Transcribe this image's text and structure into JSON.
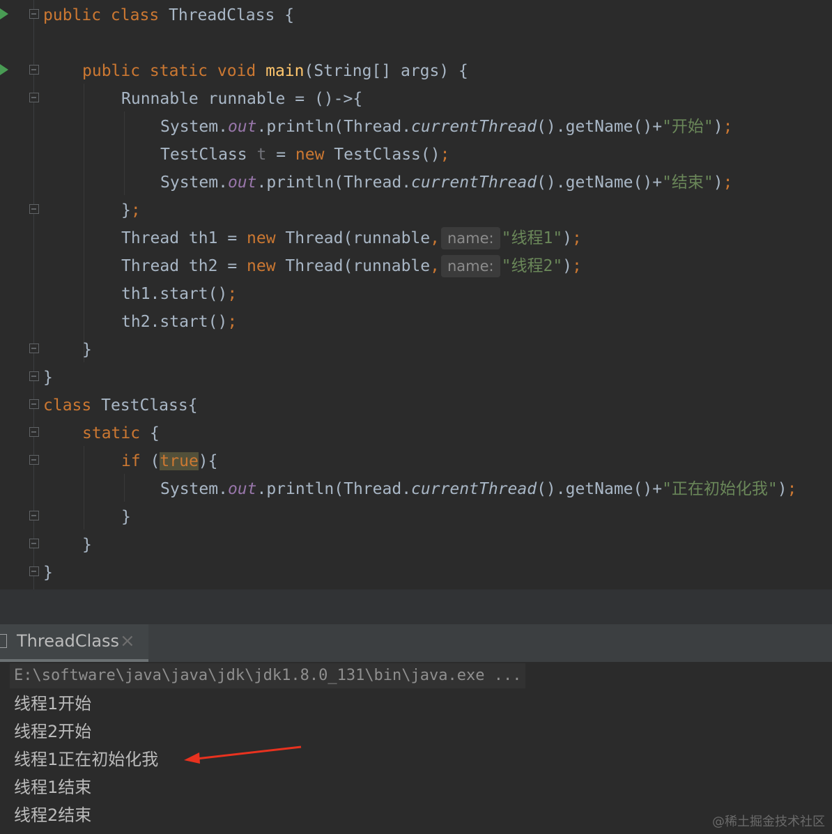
{
  "editor": {
    "line1": {
      "kw": "public class ",
      "name": "ThreadClass",
      "rest": " {"
    },
    "line3": {
      "kw": "public static void ",
      "fn": "main",
      "rest": "(String[] args) {"
    },
    "line4": {
      "text": "Runnable runnable = ()->{"
    },
    "line5": {
      "a": "System.",
      "out": "out",
      "b": ".println(Thread.",
      "ct": "currentThread",
      "c": "().getName()+",
      "str": "\"开始\"",
      "d": ")",
      "semi": ";"
    },
    "line6": {
      "a": "TestClass ",
      "v": "t",
      "b": " = ",
      "kw": "new",
      "c": " TestClass()",
      "semi": ";"
    },
    "line7": {
      "a": "System.",
      "out": "out",
      "b": ".println(Thread.",
      "ct": "currentThread",
      "c": "().getName()+",
      "str": "\"结束\"",
      "d": ")",
      "semi": ";"
    },
    "line8": {
      "a": "}",
      "semi": ";"
    },
    "line9": {
      "a": "Thread th1 = ",
      "kw": "new",
      "b": " Thread(runnable",
      "comma": ",",
      "hint": "name:",
      "str": "\"线程1\"",
      "d": ")",
      "semi": ";"
    },
    "line10": {
      "a": "Thread th2 = ",
      "kw": "new",
      "b": " Thread(runnable",
      "comma": ",",
      "hint": "name:",
      "str": "\"线程2\"",
      "d": ")",
      "semi": ";"
    },
    "line11": {
      "a": "th1.start()",
      "semi": ";"
    },
    "line12": {
      "a": "th2.start()",
      "semi": ";"
    },
    "line13": {
      "a": "}"
    },
    "line14": {
      "a": "}"
    },
    "line15": {
      "kw": "class ",
      "a": "TestClass{"
    },
    "line16": {
      "kw": "static",
      "a": " {"
    },
    "line17": {
      "kw": "if",
      "a": " (",
      "tr": "true",
      "b": "){"
    },
    "line18": {
      "a": "System.",
      "out": "out",
      "b": ".println(Thread.",
      "ct": "currentThread",
      "c": "().getName()+",
      "str": "\"正在初始化我\"",
      "d": ")",
      "semi": ";"
    },
    "line19": {
      "a": "}"
    },
    "line20": {
      "a": "}"
    },
    "line21": {
      "a": "}"
    }
  },
  "run_panel": {
    "tab_label": "ThreadClass",
    "close_glyph": "×",
    "command": "E:\\software\\java\\java\\jdk\\jdk1.8.0_131\\bin\\java.exe ...",
    "output": [
      "线程1开始",
      "线程2开始",
      "线程1正在初始化我",
      "线程1结束",
      "线程2结束"
    ]
  },
  "watermark": "@稀土掘金技术社区",
  "colors": {
    "background": "#2b2b2b",
    "keyword": "#cc7832",
    "method_decl": "#ffc66d",
    "string": "#6a8759",
    "static_field": "#9876aa",
    "text": "#a9b7c6",
    "run_icon": "#499c54",
    "annotation_arrow": "#e8321f"
  }
}
